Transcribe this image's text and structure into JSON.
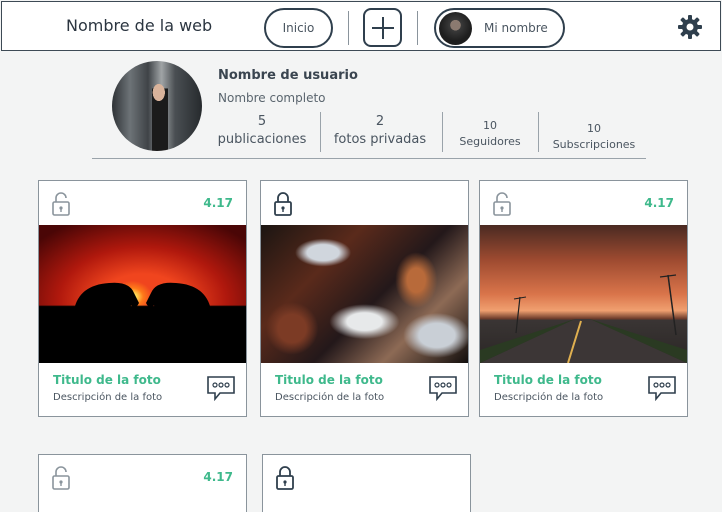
{
  "header": {
    "site_title": "Nombre de la web",
    "home_label": "Inicio",
    "add_icon": "plus-icon",
    "user_name": "Mi nombre",
    "settings_icon": "gear-icon"
  },
  "profile": {
    "username": "Nombre de usuario",
    "full_name": "Nombre completo",
    "stats": [
      {
        "value": "5",
        "label": "publicaciones"
      },
      {
        "value": "2",
        "label": "fotos privadas"
      },
      {
        "value": "10",
        "label": "Seguidores"
      },
      {
        "value": "10",
        "label": "Subscripciones"
      }
    ]
  },
  "cards": [
    {
      "rating": "4.17",
      "title": "Titulo de la foto",
      "description": "Descripción de la foto",
      "lock": "unlocked"
    },
    {
      "rating": "",
      "title": "Titulo de la foto",
      "description": "Descripción de la foto",
      "lock": "locked"
    },
    {
      "rating": "4.17",
      "title": "Titulo de la foto",
      "description": "Descripción de la foto",
      "lock": "unlocked"
    },
    {
      "rating": "4.17",
      "title": "",
      "description": "",
      "lock": "unlocked"
    },
    {
      "rating": "",
      "title": "",
      "description": "",
      "lock": "locked"
    }
  ],
  "colors": {
    "accent": "#3fb98c",
    "border": "#2f3f4d",
    "background": "#f3f4f4"
  }
}
